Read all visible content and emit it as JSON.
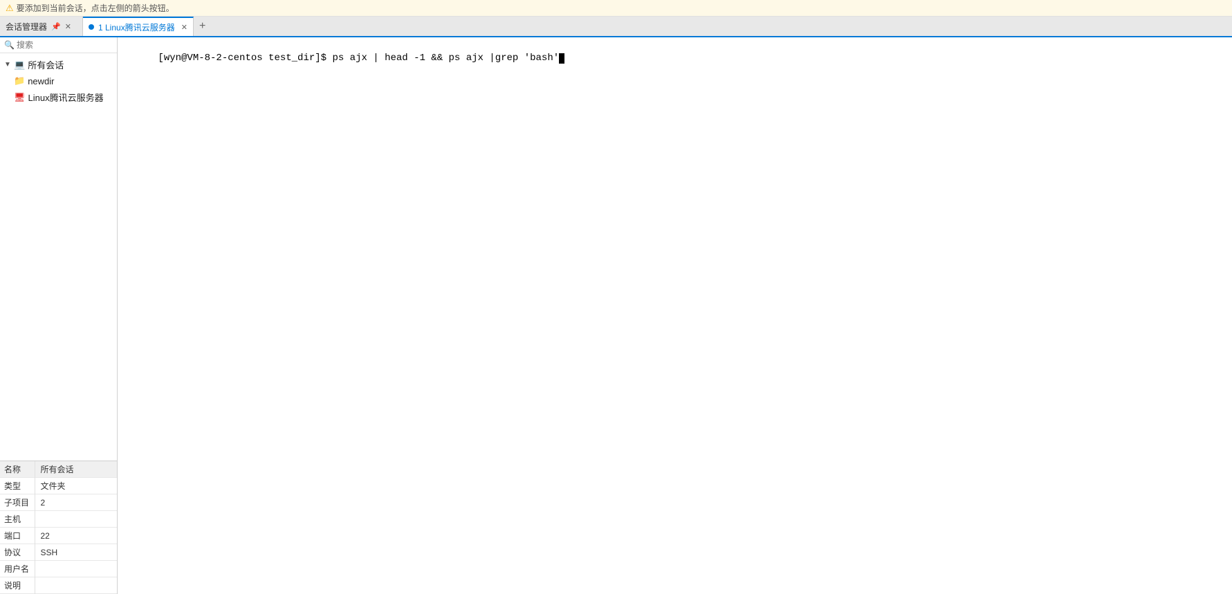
{
  "notification": {
    "icon": "⚠",
    "text": "要添加到当前会话，点击左侧的箭头按钮。"
  },
  "tabs": {
    "session_manager_label": "会话管理器",
    "active_tab_label": "1 Linux腾讯云服务器",
    "add_tab_label": "+"
  },
  "sidebar": {
    "search_placeholder": "搜索",
    "tree": {
      "root_label": "所有会话",
      "children": [
        {
          "label": "newdir",
          "type": "folder"
        },
        {
          "label": "Linux腾讯云服务器",
          "type": "server"
        }
      ]
    }
  },
  "properties": {
    "header_name": "名称",
    "header_value": "所有会话",
    "rows": [
      {
        "key": "类型",
        "value": "文件夹"
      },
      {
        "key": "子项目",
        "value": "2"
      },
      {
        "key": "主机",
        "value": ""
      },
      {
        "key": "端口",
        "value": "22"
      },
      {
        "key": "协议",
        "value": "SSH"
      },
      {
        "key": "用户名",
        "value": ""
      },
      {
        "key": "说明",
        "value": ""
      }
    ]
  },
  "terminal": {
    "prompt": "[wyn@VM-8-2-centos test_dir]$ ",
    "command": "ps ajx | head -1 && ps ajx |grep 'bash'"
  }
}
